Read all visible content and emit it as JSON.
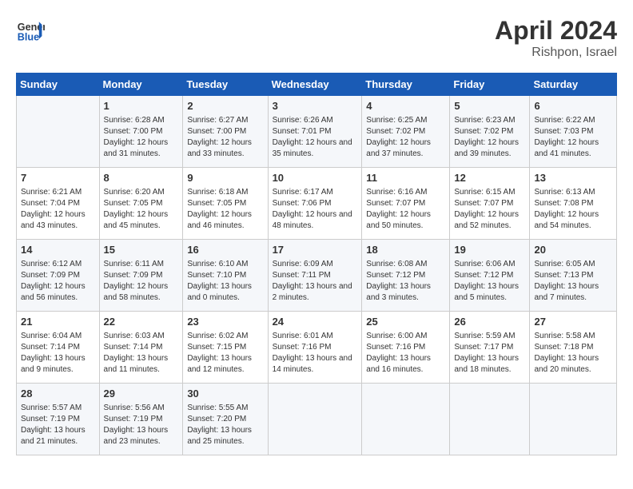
{
  "header": {
    "logo_general": "General",
    "logo_blue": "Blue",
    "month": "April 2024",
    "location": "Rishpon, Israel"
  },
  "days_of_week": [
    "Sunday",
    "Monday",
    "Tuesday",
    "Wednesday",
    "Thursday",
    "Friday",
    "Saturday"
  ],
  "weeks": [
    [
      {
        "day": "",
        "sunrise": "",
        "sunset": "",
        "daylight": ""
      },
      {
        "day": "1",
        "sunrise": "Sunrise: 6:28 AM",
        "sunset": "Sunset: 7:00 PM",
        "daylight": "Daylight: 12 hours and 31 minutes."
      },
      {
        "day": "2",
        "sunrise": "Sunrise: 6:27 AM",
        "sunset": "Sunset: 7:00 PM",
        "daylight": "Daylight: 12 hours and 33 minutes."
      },
      {
        "day": "3",
        "sunrise": "Sunrise: 6:26 AM",
        "sunset": "Sunset: 7:01 PM",
        "daylight": "Daylight: 12 hours and 35 minutes."
      },
      {
        "day": "4",
        "sunrise": "Sunrise: 6:25 AM",
        "sunset": "Sunset: 7:02 PM",
        "daylight": "Daylight: 12 hours and 37 minutes."
      },
      {
        "day": "5",
        "sunrise": "Sunrise: 6:23 AM",
        "sunset": "Sunset: 7:02 PM",
        "daylight": "Daylight: 12 hours and 39 minutes."
      },
      {
        "day": "6",
        "sunrise": "Sunrise: 6:22 AM",
        "sunset": "Sunset: 7:03 PM",
        "daylight": "Daylight: 12 hours and 41 minutes."
      }
    ],
    [
      {
        "day": "7",
        "sunrise": "Sunrise: 6:21 AM",
        "sunset": "Sunset: 7:04 PM",
        "daylight": "Daylight: 12 hours and 43 minutes."
      },
      {
        "day": "8",
        "sunrise": "Sunrise: 6:20 AM",
        "sunset": "Sunset: 7:05 PM",
        "daylight": "Daylight: 12 hours and 45 minutes."
      },
      {
        "day": "9",
        "sunrise": "Sunrise: 6:18 AM",
        "sunset": "Sunset: 7:05 PM",
        "daylight": "Daylight: 12 hours and 46 minutes."
      },
      {
        "day": "10",
        "sunrise": "Sunrise: 6:17 AM",
        "sunset": "Sunset: 7:06 PM",
        "daylight": "Daylight: 12 hours and 48 minutes."
      },
      {
        "day": "11",
        "sunrise": "Sunrise: 6:16 AM",
        "sunset": "Sunset: 7:07 PM",
        "daylight": "Daylight: 12 hours and 50 minutes."
      },
      {
        "day": "12",
        "sunrise": "Sunrise: 6:15 AM",
        "sunset": "Sunset: 7:07 PM",
        "daylight": "Daylight: 12 hours and 52 minutes."
      },
      {
        "day": "13",
        "sunrise": "Sunrise: 6:13 AM",
        "sunset": "Sunset: 7:08 PM",
        "daylight": "Daylight: 12 hours and 54 minutes."
      }
    ],
    [
      {
        "day": "14",
        "sunrise": "Sunrise: 6:12 AM",
        "sunset": "Sunset: 7:09 PM",
        "daylight": "Daylight: 12 hours and 56 minutes."
      },
      {
        "day": "15",
        "sunrise": "Sunrise: 6:11 AM",
        "sunset": "Sunset: 7:09 PM",
        "daylight": "Daylight: 12 hours and 58 minutes."
      },
      {
        "day": "16",
        "sunrise": "Sunrise: 6:10 AM",
        "sunset": "Sunset: 7:10 PM",
        "daylight": "Daylight: 13 hours and 0 minutes."
      },
      {
        "day": "17",
        "sunrise": "Sunrise: 6:09 AM",
        "sunset": "Sunset: 7:11 PM",
        "daylight": "Daylight: 13 hours and 2 minutes."
      },
      {
        "day": "18",
        "sunrise": "Sunrise: 6:08 AM",
        "sunset": "Sunset: 7:12 PM",
        "daylight": "Daylight: 13 hours and 3 minutes."
      },
      {
        "day": "19",
        "sunrise": "Sunrise: 6:06 AM",
        "sunset": "Sunset: 7:12 PM",
        "daylight": "Daylight: 13 hours and 5 minutes."
      },
      {
        "day": "20",
        "sunrise": "Sunrise: 6:05 AM",
        "sunset": "Sunset: 7:13 PM",
        "daylight": "Daylight: 13 hours and 7 minutes."
      }
    ],
    [
      {
        "day": "21",
        "sunrise": "Sunrise: 6:04 AM",
        "sunset": "Sunset: 7:14 PM",
        "daylight": "Daylight: 13 hours and 9 minutes."
      },
      {
        "day": "22",
        "sunrise": "Sunrise: 6:03 AM",
        "sunset": "Sunset: 7:14 PM",
        "daylight": "Daylight: 13 hours and 11 minutes."
      },
      {
        "day": "23",
        "sunrise": "Sunrise: 6:02 AM",
        "sunset": "Sunset: 7:15 PM",
        "daylight": "Daylight: 13 hours and 12 minutes."
      },
      {
        "day": "24",
        "sunrise": "Sunrise: 6:01 AM",
        "sunset": "Sunset: 7:16 PM",
        "daylight": "Daylight: 13 hours and 14 minutes."
      },
      {
        "day": "25",
        "sunrise": "Sunrise: 6:00 AM",
        "sunset": "Sunset: 7:16 PM",
        "daylight": "Daylight: 13 hours and 16 minutes."
      },
      {
        "day": "26",
        "sunrise": "Sunrise: 5:59 AM",
        "sunset": "Sunset: 7:17 PM",
        "daylight": "Daylight: 13 hours and 18 minutes."
      },
      {
        "day": "27",
        "sunrise": "Sunrise: 5:58 AM",
        "sunset": "Sunset: 7:18 PM",
        "daylight": "Daylight: 13 hours and 20 minutes."
      }
    ],
    [
      {
        "day": "28",
        "sunrise": "Sunrise: 5:57 AM",
        "sunset": "Sunset: 7:19 PM",
        "daylight": "Daylight: 13 hours and 21 minutes."
      },
      {
        "day": "29",
        "sunrise": "Sunrise: 5:56 AM",
        "sunset": "Sunset: 7:19 PM",
        "daylight": "Daylight: 13 hours and 23 minutes."
      },
      {
        "day": "30",
        "sunrise": "Sunrise: 5:55 AM",
        "sunset": "Sunset: 7:20 PM",
        "daylight": "Daylight: 13 hours and 25 minutes."
      },
      {
        "day": "",
        "sunrise": "",
        "sunset": "",
        "daylight": ""
      },
      {
        "day": "",
        "sunrise": "",
        "sunset": "",
        "daylight": ""
      },
      {
        "day": "",
        "sunrise": "",
        "sunset": "",
        "daylight": ""
      },
      {
        "day": "",
        "sunrise": "",
        "sunset": "",
        "daylight": ""
      }
    ]
  ]
}
